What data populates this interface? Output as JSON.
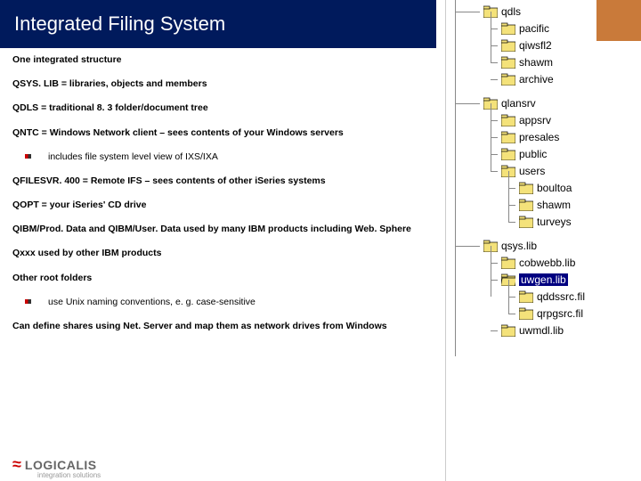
{
  "title": "Integrated Filing System",
  "lines": {
    "l0": "One integrated structure",
    "l1": "QSYS. LIB = libraries, objects and members",
    "l2": "QDLS = traditional 8. 3 folder/document tree",
    "l3": "QNTC = Windows Network client – sees contents of your Windows servers",
    "s1": "includes file system level view of IXS/IXA",
    "l4": "QFILESVR. 400 = Remote IFS – sees contents of other iSeries systems",
    "l5": "QOPT = your iSeries' CD drive",
    "l6": "QIBM/Prod. Data and QIBM/User. Data used by many IBM products including Web. Sphere",
    "l7": "Qxxx used by other IBM products",
    "l8": "Other root folders",
    "s2": "use Unix naming conventions, e. g. case-sensitive",
    "l9": "Can define shares using Net. Server and map them as network drives from Windows"
  },
  "logo": {
    "name": "LOGICALIS",
    "tag": "integration solutions"
  },
  "tree": {
    "g1": [
      {
        "label": "qdls"
      },
      {
        "label": "pacific"
      },
      {
        "label": "qiwsfl2"
      },
      {
        "label": "shawm"
      },
      {
        "label": "archive"
      }
    ],
    "g2": [
      {
        "label": "qlansrv"
      },
      {
        "label": "appsrv"
      },
      {
        "label": "presales"
      },
      {
        "label": "public"
      },
      {
        "label": "users"
      },
      {
        "label": "boultoa"
      },
      {
        "label": "shawm"
      },
      {
        "label": "turveys"
      }
    ],
    "g3": [
      {
        "label": "qsys.lib"
      },
      {
        "label": "cobwebb.lib"
      },
      {
        "label": "uwgen.lib",
        "selected": true
      },
      {
        "label": "qddssrc.fil"
      },
      {
        "label": "qrpgsrc.fil"
      },
      {
        "label": "uwmdl.lib"
      }
    ]
  }
}
